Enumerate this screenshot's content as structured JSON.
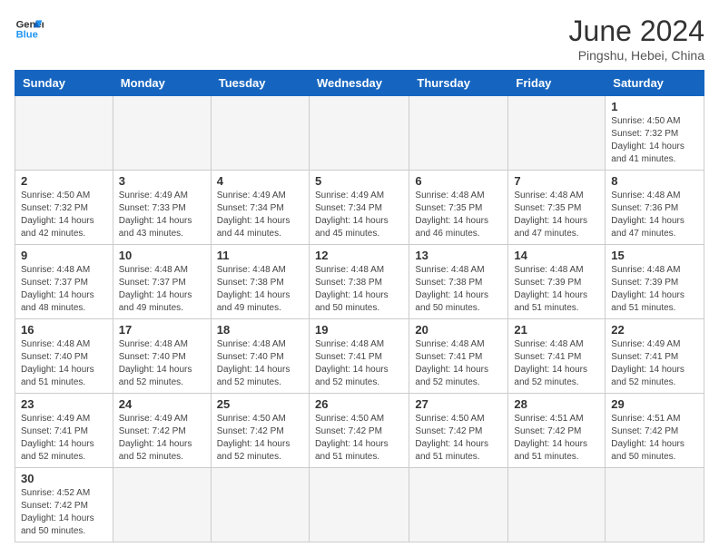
{
  "logo": {
    "line1": "General",
    "line2": "Blue"
  },
  "title": "June 2024",
  "subtitle": "Pingshu, Hebei, China",
  "days_of_week": [
    "Sunday",
    "Monday",
    "Tuesday",
    "Wednesday",
    "Thursday",
    "Friday",
    "Saturday"
  ],
  "weeks": [
    [
      {
        "day": "",
        "info": ""
      },
      {
        "day": "",
        "info": ""
      },
      {
        "day": "",
        "info": ""
      },
      {
        "day": "",
        "info": ""
      },
      {
        "day": "",
        "info": ""
      },
      {
        "day": "",
        "info": ""
      },
      {
        "day": "1",
        "info": "Sunrise: 4:50 AM\nSunset: 7:32 PM\nDaylight: 14 hours and 41 minutes."
      }
    ],
    [
      {
        "day": "2",
        "info": "Sunrise: 4:50 AM\nSunset: 7:32 PM\nDaylight: 14 hours and 42 minutes."
      },
      {
        "day": "3",
        "info": "Sunrise: 4:49 AM\nSunset: 7:33 PM\nDaylight: 14 hours and 43 minutes."
      },
      {
        "day": "4",
        "info": "Sunrise: 4:49 AM\nSunset: 7:34 PM\nDaylight: 14 hours and 44 minutes."
      },
      {
        "day": "5",
        "info": "Sunrise: 4:49 AM\nSunset: 7:34 PM\nDaylight: 14 hours and 45 minutes."
      },
      {
        "day": "6",
        "info": "Sunrise: 4:48 AM\nSunset: 7:35 PM\nDaylight: 14 hours and 46 minutes."
      },
      {
        "day": "7",
        "info": "Sunrise: 4:48 AM\nSunset: 7:35 PM\nDaylight: 14 hours and 47 minutes."
      },
      {
        "day": "8",
        "info": "Sunrise: 4:48 AM\nSunset: 7:36 PM\nDaylight: 14 hours and 47 minutes."
      }
    ],
    [
      {
        "day": "9",
        "info": "Sunrise: 4:48 AM\nSunset: 7:37 PM\nDaylight: 14 hours and 48 minutes."
      },
      {
        "day": "10",
        "info": "Sunrise: 4:48 AM\nSunset: 7:37 PM\nDaylight: 14 hours and 49 minutes."
      },
      {
        "day": "11",
        "info": "Sunrise: 4:48 AM\nSunset: 7:38 PM\nDaylight: 14 hours and 49 minutes."
      },
      {
        "day": "12",
        "info": "Sunrise: 4:48 AM\nSunset: 7:38 PM\nDaylight: 14 hours and 50 minutes."
      },
      {
        "day": "13",
        "info": "Sunrise: 4:48 AM\nSunset: 7:38 PM\nDaylight: 14 hours and 50 minutes."
      },
      {
        "day": "14",
        "info": "Sunrise: 4:48 AM\nSunset: 7:39 PM\nDaylight: 14 hours and 51 minutes."
      },
      {
        "day": "15",
        "info": "Sunrise: 4:48 AM\nSunset: 7:39 PM\nDaylight: 14 hours and 51 minutes."
      }
    ],
    [
      {
        "day": "16",
        "info": "Sunrise: 4:48 AM\nSunset: 7:40 PM\nDaylight: 14 hours and 51 minutes."
      },
      {
        "day": "17",
        "info": "Sunrise: 4:48 AM\nSunset: 7:40 PM\nDaylight: 14 hours and 52 minutes."
      },
      {
        "day": "18",
        "info": "Sunrise: 4:48 AM\nSunset: 7:40 PM\nDaylight: 14 hours and 52 minutes."
      },
      {
        "day": "19",
        "info": "Sunrise: 4:48 AM\nSunset: 7:41 PM\nDaylight: 14 hours and 52 minutes."
      },
      {
        "day": "20",
        "info": "Sunrise: 4:48 AM\nSunset: 7:41 PM\nDaylight: 14 hours and 52 minutes."
      },
      {
        "day": "21",
        "info": "Sunrise: 4:48 AM\nSunset: 7:41 PM\nDaylight: 14 hours and 52 minutes."
      },
      {
        "day": "22",
        "info": "Sunrise: 4:49 AM\nSunset: 7:41 PM\nDaylight: 14 hours and 52 minutes."
      }
    ],
    [
      {
        "day": "23",
        "info": "Sunrise: 4:49 AM\nSunset: 7:41 PM\nDaylight: 14 hours and 52 minutes."
      },
      {
        "day": "24",
        "info": "Sunrise: 4:49 AM\nSunset: 7:42 PM\nDaylight: 14 hours and 52 minutes."
      },
      {
        "day": "25",
        "info": "Sunrise: 4:50 AM\nSunset: 7:42 PM\nDaylight: 14 hours and 52 minutes."
      },
      {
        "day": "26",
        "info": "Sunrise: 4:50 AM\nSunset: 7:42 PM\nDaylight: 14 hours and 51 minutes."
      },
      {
        "day": "27",
        "info": "Sunrise: 4:50 AM\nSunset: 7:42 PM\nDaylight: 14 hours and 51 minutes."
      },
      {
        "day": "28",
        "info": "Sunrise: 4:51 AM\nSunset: 7:42 PM\nDaylight: 14 hours and 51 minutes."
      },
      {
        "day": "29",
        "info": "Sunrise: 4:51 AM\nSunset: 7:42 PM\nDaylight: 14 hours and 50 minutes."
      }
    ],
    [
      {
        "day": "30",
        "info": "Sunrise: 4:52 AM\nSunset: 7:42 PM\nDaylight: 14 hours and 50 minutes."
      },
      {
        "day": "",
        "info": ""
      },
      {
        "day": "",
        "info": ""
      },
      {
        "day": "",
        "info": ""
      },
      {
        "day": "",
        "info": ""
      },
      {
        "day": "",
        "info": ""
      },
      {
        "day": "",
        "info": ""
      }
    ]
  ]
}
